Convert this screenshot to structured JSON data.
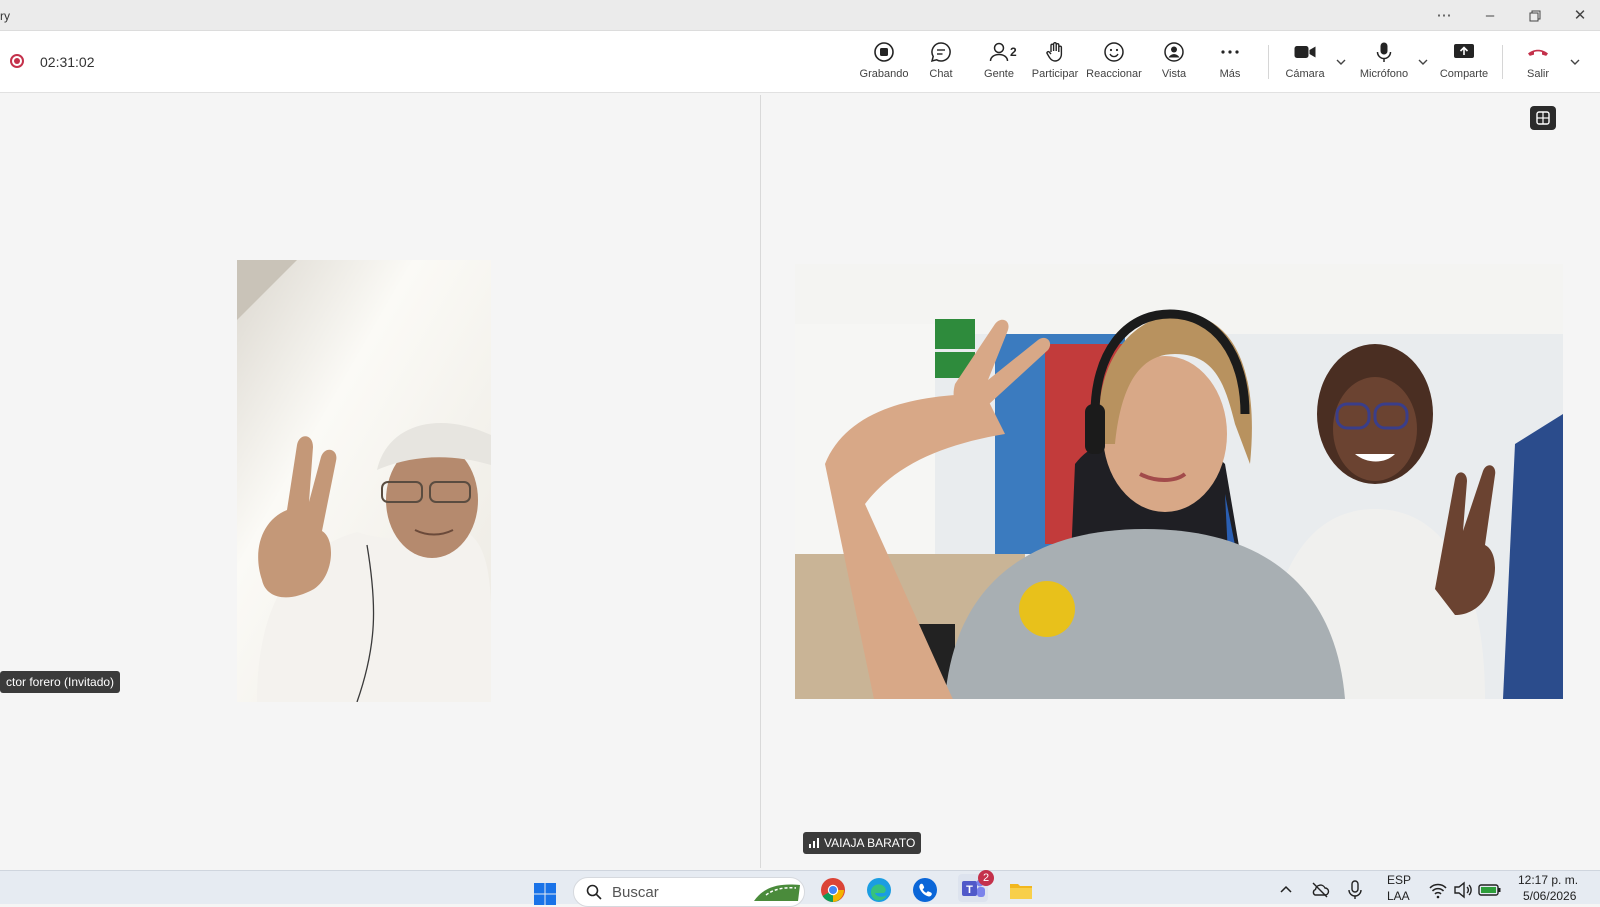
{
  "window": {
    "title": "ry"
  },
  "toolbar": {
    "timer": "02:31:02",
    "buttons": {
      "record": "Grabando",
      "chat": "Chat",
      "people": "Gente",
      "people_count": "2",
      "raise": "Participar",
      "react": "Reaccionar",
      "view": "Vista",
      "more": "Más",
      "camera": "Cámara",
      "mic": "Micrófono",
      "share": "Comparte",
      "leave": "Salir"
    },
    "colors": {
      "leave": "#c4314b",
      "recording": "#c4314b"
    }
  },
  "participants": [
    {
      "name": "ctor forero (Invitado)"
    },
    {
      "name": "VAIAJA BARATO"
    }
  ],
  "taskbar": {
    "search_placeholder": "Buscar",
    "teams_badge": "2",
    "lang_top": "ESP",
    "lang_bottom": "LAA",
    "time": "12:17 p. m.",
    "date": "5/06/2026"
  }
}
